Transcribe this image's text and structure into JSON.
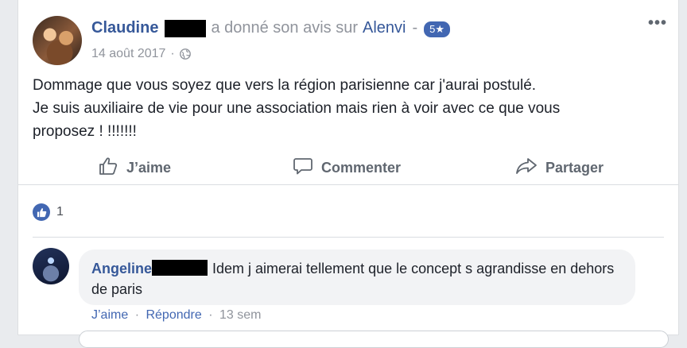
{
  "post": {
    "author_name": "Claudine",
    "action_text": "a donné son avis sur",
    "page_name": "Alenvi",
    "separator": "-",
    "rating": "5★",
    "date": "14 août 2017",
    "meta_dot": "·",
    "privacy_icon": "globe-icon",
    "more_icon": "•••",
    "text_lines": [
      "Dommage que vous soyez que vers la région parisienne car j'aurai postulé.",
      "Je suis auxiliaire de vie pour une association mais rien à voir avec ce que vous",
      "proposez ! !!!!!!!"
    ]
  },
  "actions": {
    "like_label": "J’aime",
    "comment_label": "Commenter",
    "share_label": "Partager"
  },
  "reactions": {
    "count": "1",
    "icon": "thumbs-up-icon"
  },
  "comment": {
    "author_name": "Angeline",
    "text": "Idem j aimerai tellement que le concept s agrandisse en dehors de paris",
    "like_label": "J’aime",
    "reply_label": "Répondre",
    "dot": "·",
    "time": "13 sem"
  },
  "colors": {
    "link_blue": "#365899",
    "accent_blue": "#4267b2",
    "gray_text": "#90949c"
  }
}
